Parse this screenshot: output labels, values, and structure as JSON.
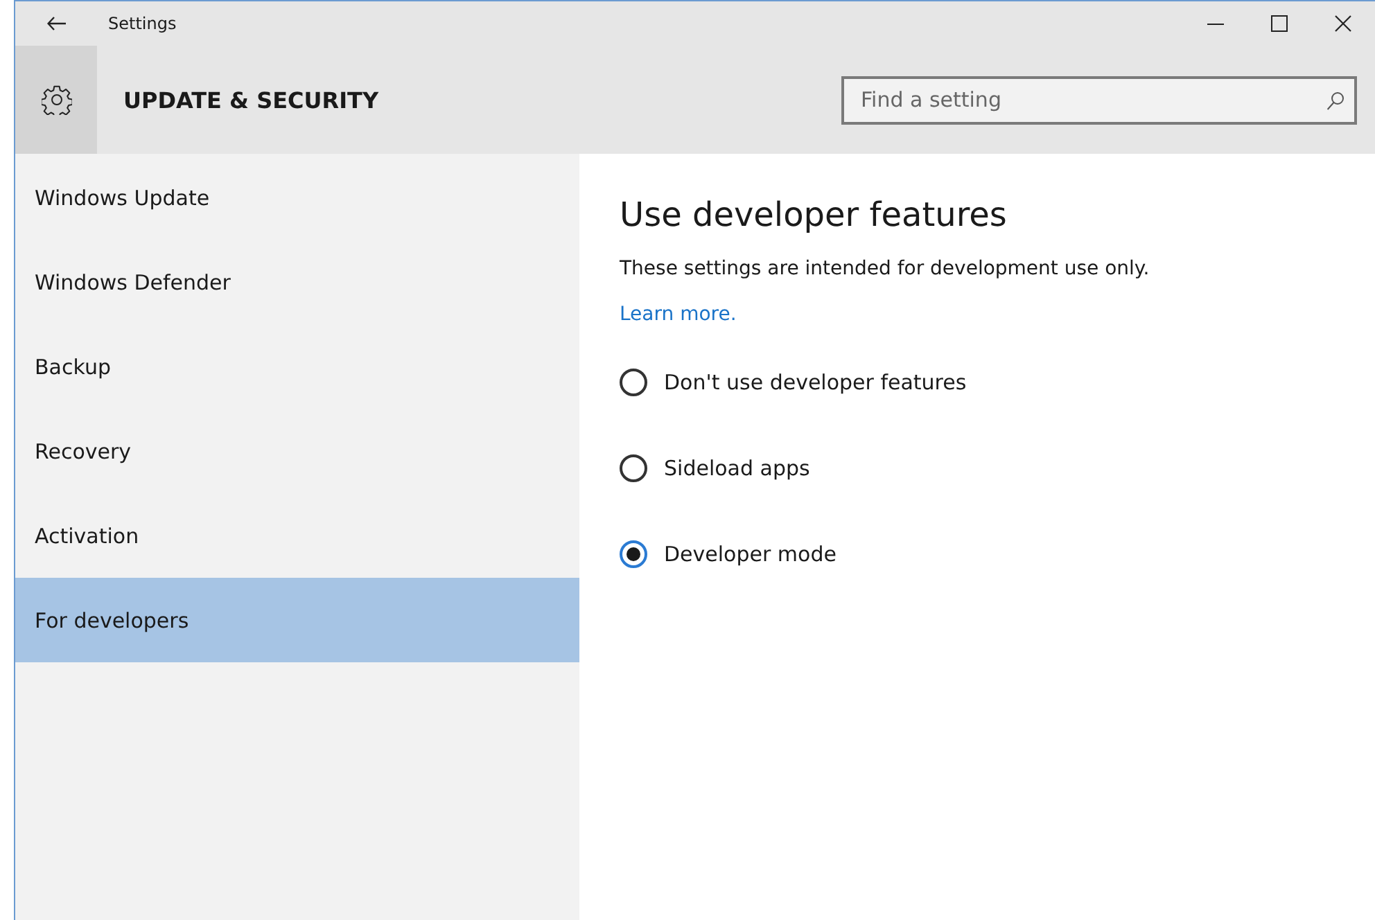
{
  "window": {
    "title": "Settings"
  },
  "header": {
    "title": "UPDATE & SECURITY"
  },
  "search": {
    "placeholder": "Find a setting"
  },
  "sidebar": {
    "items": [
      {
        "label": "Windows Update",
        "selected": false
      },
      {
        "label": "Windows Defender",
        "selected": false
      },
      {
        "label": "Backup",
        "selected": false
      },
      {
        "label": "Recovery",
        "selected": false
      },
      {
        "label": "Activation",
        "selected": false
      },
      {
        "label": "For developers",
        "selected": true
      }
    ]
  },
  "content": {
    "heading": "Use developer features",
    "description": "These settings are intended for development use only.",
    "link": "Learn more.",
    "options": [
      {
        "label": "Don't use developer features",
        "selected": false
      },
      {
        "label": "Sideload apps",
        "selected": false
      },
      {
        "label": "Developer mode",
        "selected": true
      }
    ]
  }
}
